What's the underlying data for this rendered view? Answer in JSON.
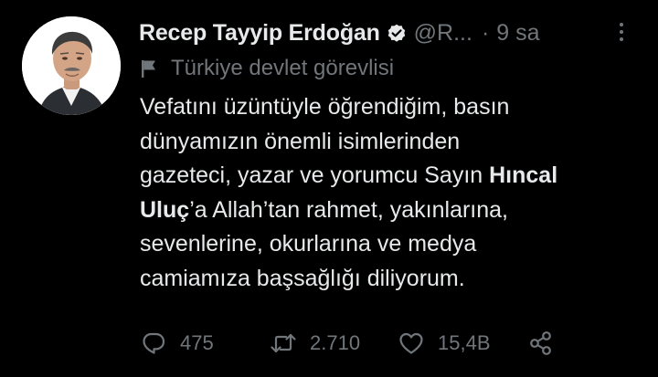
{
  "author": {
    "display_name": "Recep Tayyip Erdoğan",
    "handle": "@R...",
    "separator": "·",
    "time": "9 sa",
    "verified_icon": "verified-badge-icon",
    "avatar_icon": "profile-photo"
  },
  "label": {
    "icon": "flag-icon",
    "text": "Türkiye devlet görevlisi"
  },
  "tweet": {
    "lines": [
      {
        "pre": "Vefatını üzüntüyle öğrendiğim, basın",
        "bold": "",
        "post": ""
      },
      {
        "pre": "dünyamızın önemli isimlerinden",
        "bold": "",
        "post": ""
      },
      {
        "pre": "gazeteci, yazar ve yorumcu Sayın ",
        "bold": "Hıncal",
        "post": ""
      },
      {
        "pre": "",
        "bold": "Uluç",
        "post": "’a Allah’tan rahmet, yakınlarına,"
      },
      {
        "pre": "sevenlerine, okurlarına ve medya",
        "bold": "",
        "post": ""
      },
      {
        "pre": "camiamıza başsağlığı diliyorum.",
        "bold": "",
        "post": ""
      }
    ]
  },
  "actions": {
    "reply_count": "475",
    "retweet_count": "2.710",
    "like_count": "15,4B"
  },
  "colors": {
    "background": "#000000",
    "primary_text": "#e7e9ea",
    "secondary_text": "#71767b"
  }
}
